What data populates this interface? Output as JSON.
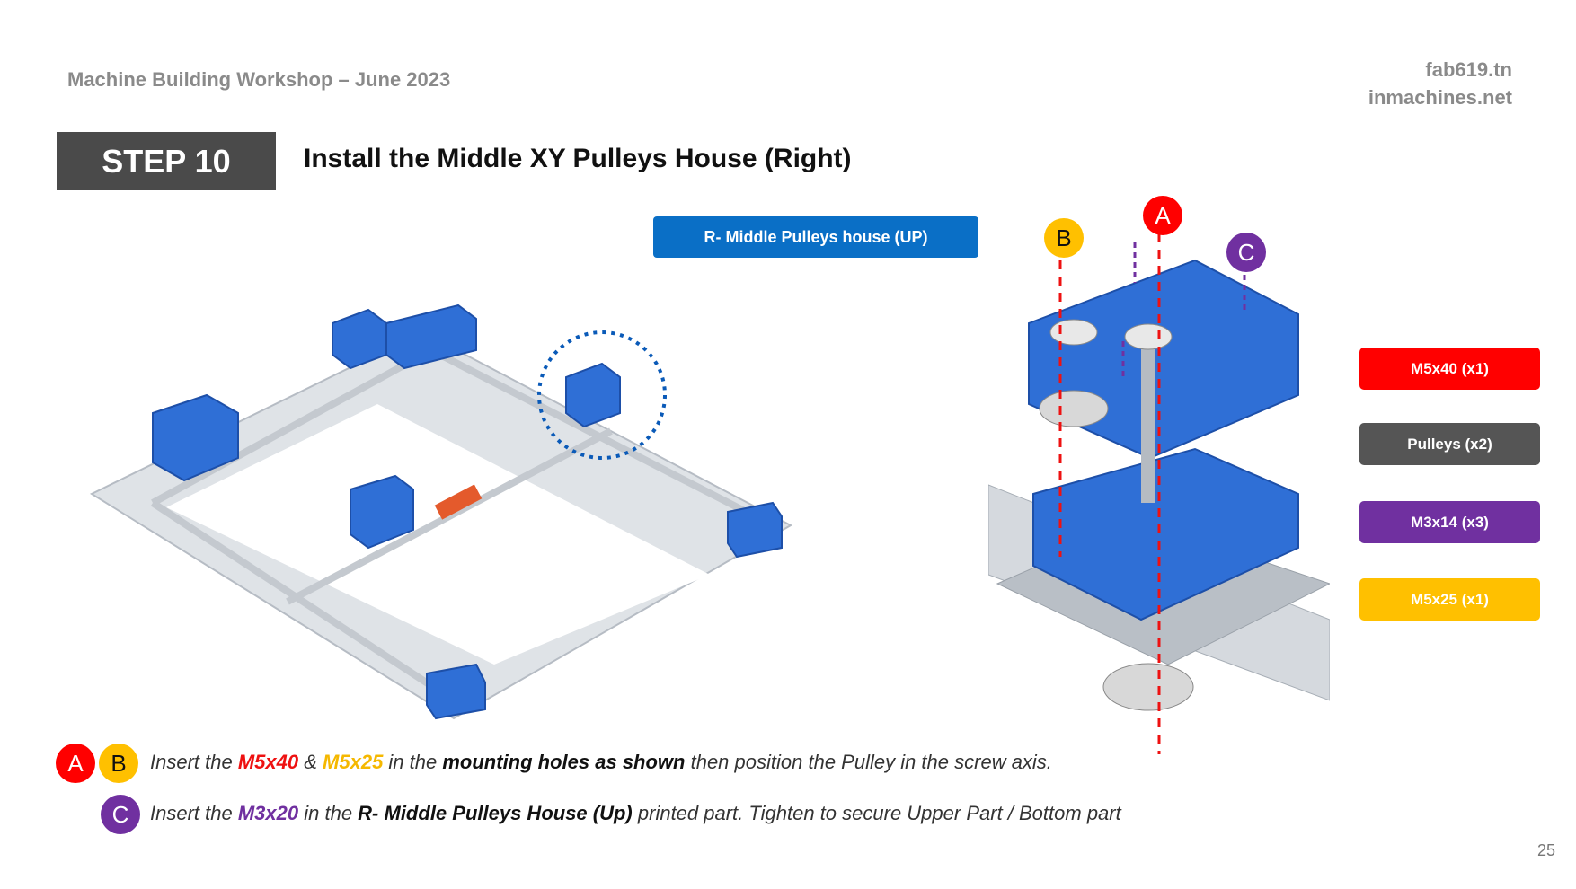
{
  "header": {
    "workshop": "Machine Building Workshop – June 2023",
    "site1": "fab619.tn",
    "site2": "inmachines.net"
  },
  "step": {
    "label": "STEP 10",
    "title": "Install the Middle XY Pulleys House (Right)"
  },
  "part_label": "R- Middle Pulleys house (UP)",
  "callouts": {
    "a": "A",
    "b": "B",
    "c": "C"
  },
  "legend": [
    {
      "label": "M5x40 (x1)",
      "color": "#ff0000"
    },
    {
      "label": "Pulleys (x2)",
      "color": "#555555"
    },
    {
      "label": "M3x14 (x3)",
      "color": "#7030a0"
    },
    {
      "label": "M5x25 (x1)",
      "color": "#ffc000"
    }
  ],
  "instructions": {
    "line1": {
      "t1": "Insert the ",
      "m5x40": "M5x40",
      "t2": " & ",
      "m5x25": "M5x25",
      "t3": "  in the ",
      "bold": "mounting holes as shown",
      "t4": " then position the Pulley in the screw axis."
    },
    "line2": {
      "t1": "Insert the ",
      "m3x20": "M3x20",
      "t2": "  in the ",
      "bold": "R- Middle Pulleys House (Up)",
      "t3": " printed part. Tighten to secure Upper Part / Bottom part"
    }
  },
  "page_number": "25",
  "colors": {
    "accent_blue": "#0a6fc6",
    "part_blue": "#2f6fd6",
    "dark_gray": "#4a4a4a"
  }
}
